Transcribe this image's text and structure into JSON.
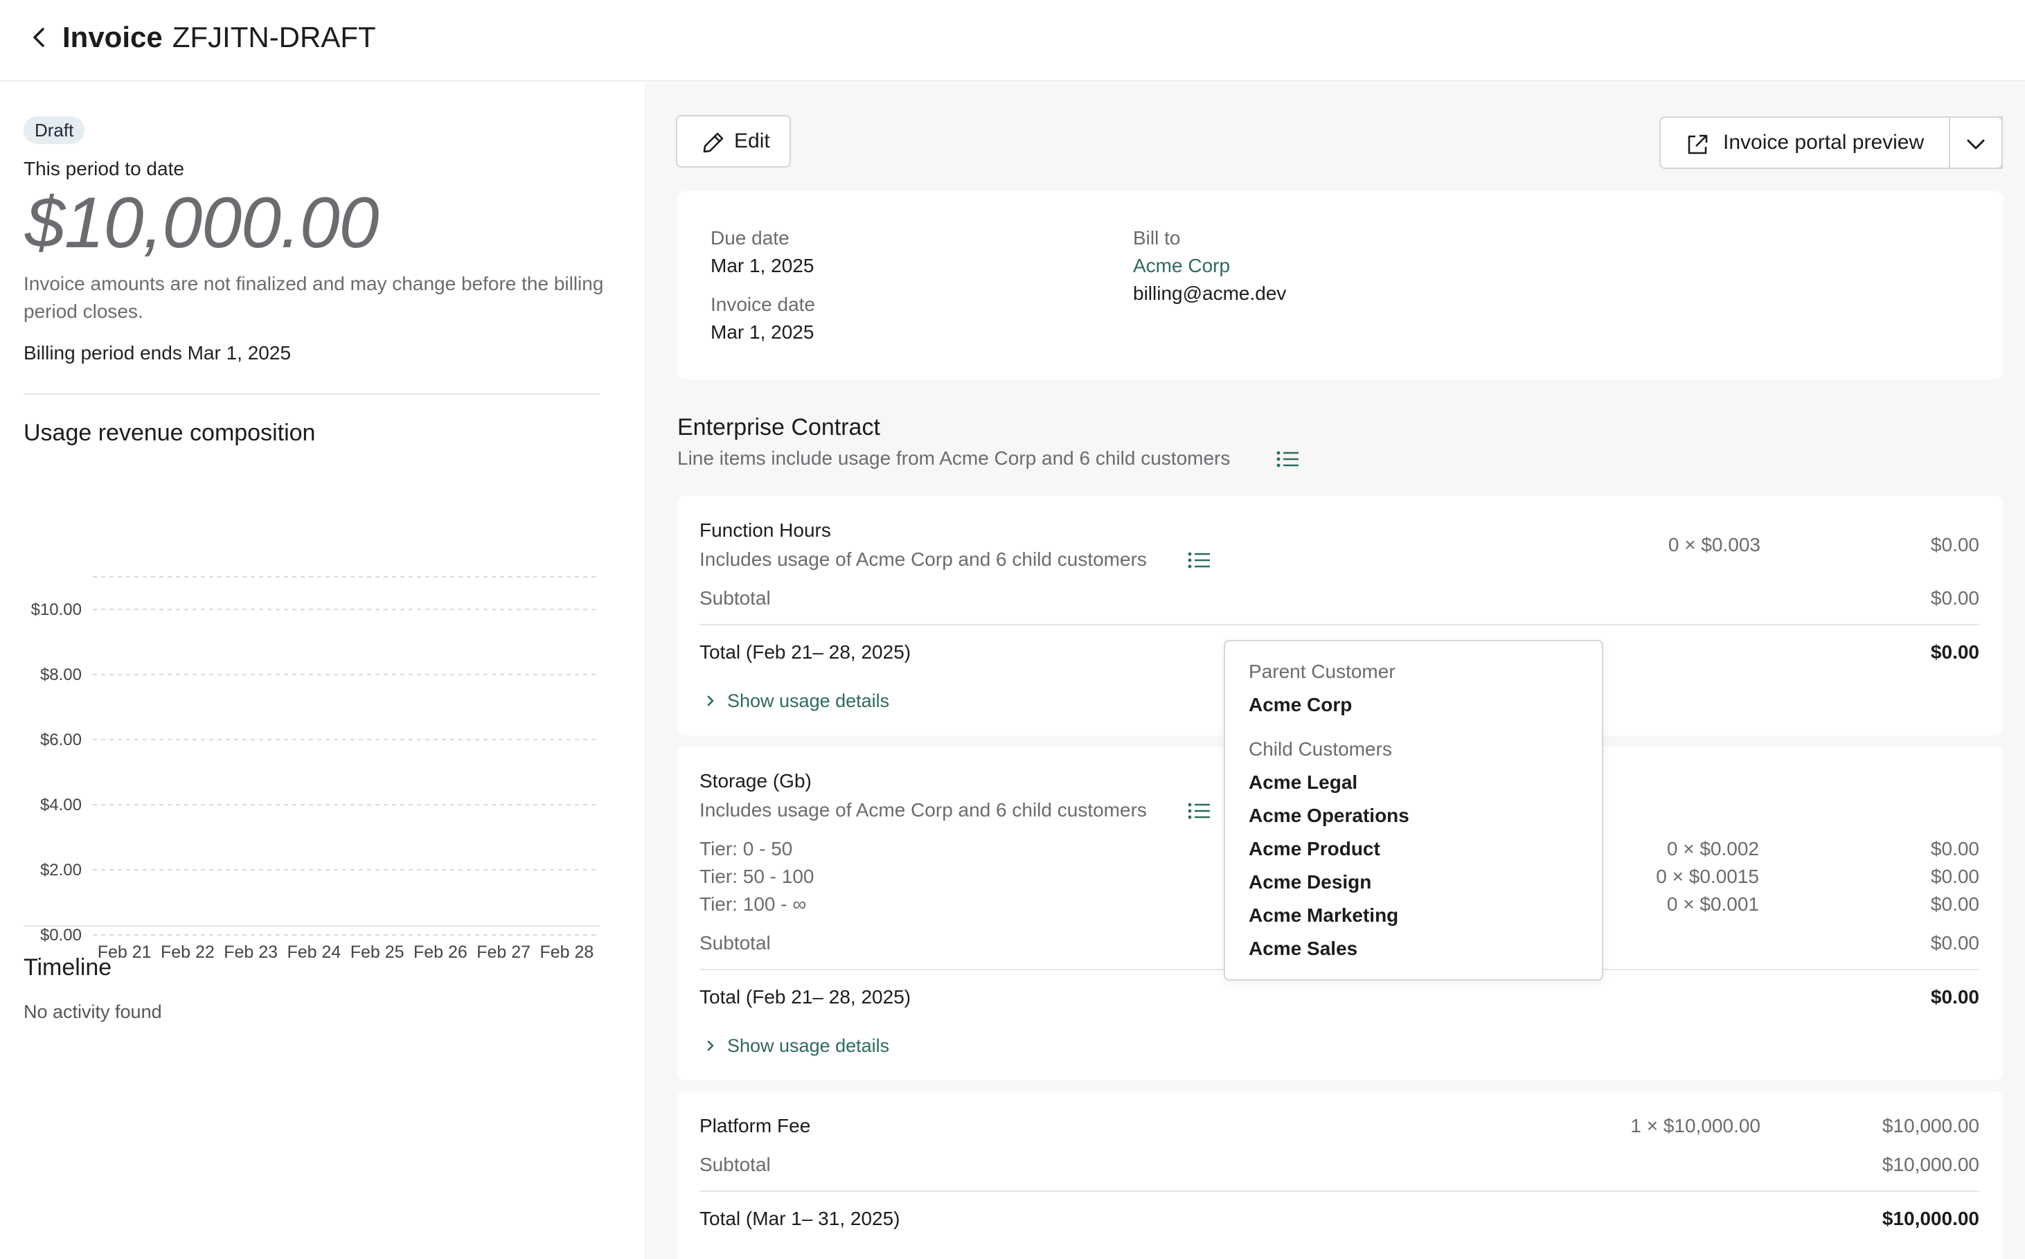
{
  "header": {
    "back_icon": "chevron-left-icon",
    "title": "Invoice",
    "invoice_id": "ZFJITN-DRAFT"
  },
  "summary": {
    "status": "Draft",
    "period_label": "This period to date",
    "amount": "$10,000.00",
    "note": "Invoice amounts are not finalized and may change before the billing period closes.",
    "billing_period_ends": "Billing period ends Mar 1, 2025"
  },
  "usage_chart": {
    "title": "Usage revenue composition",
    "chart_data": {
      "type": "bar",
      "categories": [
        "Feb 21",
        "Feb 22",
        "Feb 23",
        "Feb 24",
        "Feb 25",
        "Feb 26",
        "Feb 27",
        "Feb 28"
      ],
      "values": [
        0,
        0,
        0,
        0,
        0,
        0,
        0,
        0
      ],
      "y_ticks": [
        "$0.00",
        "$2.00",
        "$4.00",
        "$6.00",
        "$8.00",
        "$10.00"
      ],
      "ylim": [
        0,
        10
      ],
      "grid": true
    }
  },
  "timeline": {
    "title": "Timeline",
    "empty_text": "No activity found"
  },
  "toolbar": {
    "edit_label": "Edit",
    "edit_icon": "pencil-icon",
    "portal_label": "Invoice portal preview",
    "portal_icon": "external-link-icon",
    "dropdown_icon": "chevron-down-icon"
  },
  "details": {
    "due_date_label": "Due date",
    "due_date": "Mar 1, 2025",
    "invoice_date_label": "Invoice date",
    "invoice_date": "Mar 1, 2025",
    "bill_to_label": "Bill to",
    "customer_name": "Acme Corp",
    "customer_email": "billing@acme.dev"
  },
  "contract": {
    "title": "Enterprise Contract",
    "subtitle": "Line items include usage from Acme Corp and 6 child customers"
  },
  "line_items": {
    "function_hours": {
      "name": "Function Hours",
      "includes": "Includes usage of Acme Corp and 6 child customers",
      "quantity_price": "0 × $0.003",
      "amount": "$0.00",
      "subtotal_label": "Subtotal",
      "subtotal": "$0.00",
      "total_label": "Total (Feb 21– 28, 2025)",
      "total": "$0.00",
      "show_details": "Show usage details"
    },
    "storage": {
      "name": "Storage (Gb)",
      "includes": "Includes usage of Acme Corp and 6 child customers",
      "tiers": [
        {
          "label": "Tier: 0 - 50",
          "quantity_price": "0 × $0.002",
          "amount": "$0.00"
        },
        {
          "label": "Tier: 50 - 100",
          "quantity_price": "0 × $0.0015",
          "amount": "$0.00"
        },
        {
          "label": "Tier: 100 - ∞",
          "quantity_price": "0 × $0.001",
          "amount": "$0.00"
        }
      ],
      "subtotal_label": "Subtotal",
      "subtotal": "$0.00",
      "total_label": "Total (Feb 21– 28, 2025)",
      "total": "$0.00",
      "show_details": "Show usage details"
    },
    "platform_fee": {
      "name": "Platform Fee",
      "quantity_price": "1 × $10,000.00",
      "amount": "$10,000.00",
      "subtotal_label": "Subtotal",
      "subtotal": "$10,000.00",
      "total_label": "Total (Mar 1– 31, 2025)",
      "total": "$10,000.00"
    }
  },
  "popover": {
    "parent_heading": "Parent Customer",
    "parent": "Acme Corp",
    "child_heading": "Child Customers",
    "children": [
      "Acme Legal",
      "Acme Operations",
      "Acme Product",
      "Acme Design",
      "Acme Marketing",
      "Acme Sales"
    ]
  },
  "colors": {
    "accent": "#2e6a5f",
    "badge_bg": "#e6edf1",
    "panel_bg": "#f7f7f8",
    "muted_text": "#6b6b70"
  }
}
